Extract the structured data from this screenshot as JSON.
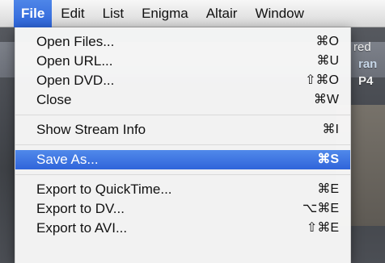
{
  "menubar": {
    "items": [
      "File",
      "Edit",
      "List",
      "Enigma",
      "Altair",
      "Window"
    ],
    "active": "File"
  },
  "background": {
    "text_1": "red",
    "text_2": "ran",
    "text_3": "P4"
  },
  "file_menu": {
    "items": [
      {
        "label": "Open Files...",
        "shortcut": "⌘O"
      },
      {
        "label": "Open URL...",
        "shortcut": "⌘U"
      },
      {
        "label": "Open DVD...",
        "shortcut": "⇧⌘O"
      },
      {
        "label": "Close",
        "shortcut": "⌘W"
      },
      {
        "label": "Show Stream Info",
        "shortcut": "⌘I"
      },
      {
        "label": "Save As...",
        "shortcut": "⌘S",
        "highlighted": true
      },
      {
        "label": "Export to QuickTime...",
        "shortcut": "⌘E"
      },
      {
        "label": "Export to DV...",
        "shortcut": "⌥⌘E"
      },
      {
        "label": "Export to AVI...",
        "shortcut": "⇧⌘E"
      }
    ]
  },
  "colors": {
    "highlight": "#2f64da",
    "menubar_bg": "#e6e6e6"
  }
}
